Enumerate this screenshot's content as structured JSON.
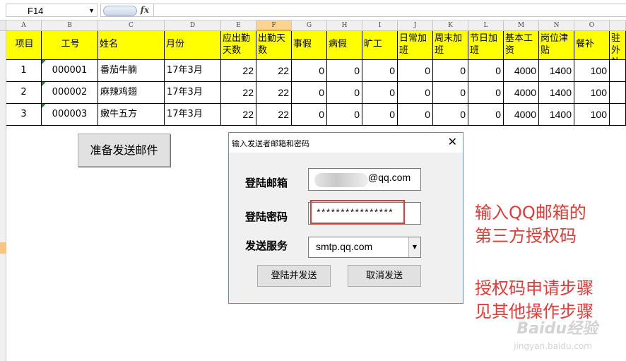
{
  "formula_bar": {
    "name_box": "F14",
    "fx": "fx",
    "content": ""
  },
  "columns": [
    "A",
    "B",
    "C",
    "D",
    "E",
    "F",
    "G",
    "H",
    "I",
    "J",
    "K",
    "L",
    "M",
    "N",
    "O",
    ""
  ],
  "headers": [
    "项目",
    "工号",
    "姓名",
    "月份",
    "应出勤天数",
    "出勤天数",
    "事假",
    "病假",
    "旷工",
    "日常加班",
    "周末加班",
    "节日加班",
    "基本工资",
    "岗位津贴",
    "餐补",
    "驻外补贴"
  ],
  "rows": [
    [
      "1",
      "000001",
      "番茄牛腩",
      "17年3月",
      "22",
      "22",
      "0",
      "0",
      "0",
      "0",
      "0",
      "0",
      "4000",
      "1400",
      "100",
      ""
    ],
    [
      "2",
      "000002",
      "麻辣鸡翅",
      "17年3月",
      "22",
      "22",
      "0",
      "0",
      "0",
      "0",
      "0",
      "0",
      "4000",
      "1400",
      "100",
      ""
    ],
    [
      "3",
      "000003",
      "嫩牛五方",
      "17年3月",
      "22",
      "22",
      "0",
      "0",
      "0",
      "0",
      "0",
      "0",
      "4000",
      "1400",
      "100",
      ""
    ]
  ],
  "sheet_button": "准备发送邮件",
  "dialog": {
    "title": "输入发送者邮箱和密码",
    "close": "✕",
    "email_label": "登陆邮箱",
    "email_value": "@qq.com",
    "password_label": "登陆密码",
    "password_value": "****************",
    "server_label": "发送服务",
    "server_value": "smtp.qq.com",
    "login_send": "登陆并发送",
    "cancel_send": "取消发送"
  },
  "annotations": {
    "line1": "输入QQ邮箱的",
    "line2": "第三方授权码",
    "line3": "授权码申请步骤",
    "line4": "见其他操作步骤"
  },
  "watermark": {
    "main": "Baidu经验",
    "sub": "jingyan.baidu.com"
  }
}
